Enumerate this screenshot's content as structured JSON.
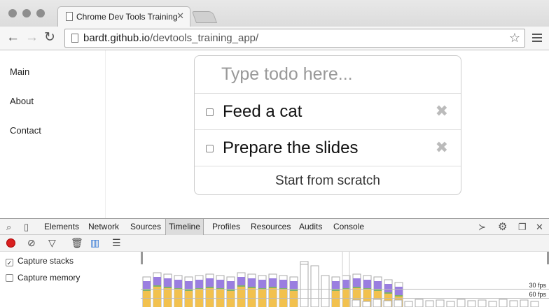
{
  "browser": {
    "tab_title": "Chrome Dev Tools Training",
    "url_host": "bardt.github.io",
    "url_path": "/devtools_training_app/"
  },
  "sidebar": {
    "items": [
      {
        "label": "Main"
      },
      {
        "label": "About"
      },
      {
        "label": "Contact"
      }
    ]
  },
  "todo": {
    "placeholder": "Type todo here...",
    "items": [
      {
        "text": "Feed a cat",
        "done": false
      },
      {
        "text": "Prepare the slides",
        "done": false
      }
    ],
    "reset_label": "Start from scratch"
  },
  "devtools": {
    "tabs": [
      "Elements",
      "Network",
      "Sources",
      "Timeline",
      "Profiles",
      "Resources",
      "Audits",
      "Console"
    ],
    "active_tab": "Timeline",
    "options": [
      {
        "label": "Capture stacks",
        "checked": true
      },
      {
        "label": "Capture memory",
        "checked": false
      }
    ],
    "fps_labels": {
      "fps30": "30 fps",
      "fps60": "60 fps"
    },
    "colors": {
      "scripting": "#f2c14e",
      "rendering": "#9a7ee0",
      "painting": "#7fb26a",
      "record": "#d92020"
    }
  }
}
